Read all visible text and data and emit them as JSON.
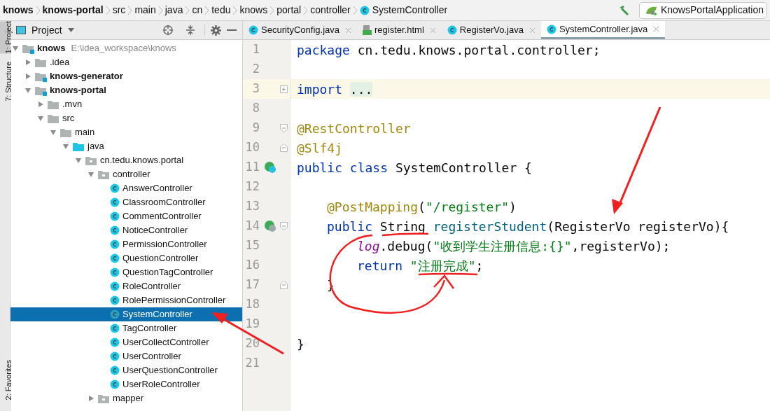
{
  "breadcrumbs": [
    {
      "label": "knows",
      "bold": true
    },
    {
      "label": "knows-portal",
      "bold": true
    },
    {
      "label": "src",
      "bold": false
    },
    {
      "label": "main",
      "bold": false
    },
    {
      "label": "java",
      "bold": false
    },
    {
      "label": "cn",
      "bold": false
    },
    {
      "label": "tedu",
      "bold": false
    },
    {
      "label": "knows",
      "bold": false
    },
    {
      "label": "portal",
      "bold": false
    },
    {
      "label": "controller",
      "bold": false
    },
    {
      "label": "SystemController",
      "bold": false,
      "kind": "class"
    }
  ],
  "run_config": {
    "label": "KnowsPortalApplication"
  },
  "side_tabs": [
    {
      "label": "1: Project",
      "selected": true
    },
    {
      "label": "7: Structure",
      "selected": false
    },
    {
      "label": "2: Favorites",
      "selected": false
    }
  ],
  "project_panel": {
    "title": "Project",
    "tree": [
      {
        "label": "knows",
        "kind": "module",
        "bold": true,
        "location": "E:\\idea_workspace\\knows",
        "expanded": true,
        "children": [
          {
            "label": ".idea",
            "kind": "folder",
            "expanded": false
          },
          {
            "label": "knows-generator",
            "kind": "module",
            "bold": true,
            "expanded": false
          },
          {
            "label": "knows-portal",
            "kind": "module",
            "bold": true,
            "expanded": true,
            "children": [
              {
                "label": ".mvn",
                "kind": "folder",
                "expanded": false
              },
              {
                "label": "src",
                "kind": "folder",
                "expanded": true,
                "children": [
                  {
                    "label": "main",
                    "kind": "folder",
                    "expanded": true,
                    "children": [
                      {
                        "label": "java",
                        "kind": "source-folder",
                        "expanded": true,
                        "children": [
                          {
                            "label": "cn.tedu.knows.portal",
                            "kind": "package",
                            "expanded": true,
                            "children": [
                              {
                                "label": "controller",
                                "kind": "package",
                                "expanded": true,
                                "children": [
                                  {
                                    "label": "AnswerController",
                                    "kind": "class",
                                    "selected": false
                                  },
                                  {
                                    "label": "ClassroomController",
                                    "kind": "class",
                                    "selected": false
                                  },
                                  {
                                    "label": "CommentController",
                                    "kind": "class",
                                    "selected": false
                                  },
                                  {
                                    "label": "NoticeController",
                                    "kind": "class",
                                    "selected": false
                                  },
                                  {
                                    "label": "PermissionController",
                                    "kind": "class",
                                    "selected": false
                                  },
                                  {
                                    "label": "QuestionController",
                                    "kind": "class",
                                    "selected": false
                                  },
                                  {
                                    "label": "QuestionTagController",
                                    "kind": "class",
                                    "selected": false
                                  },
                                  {
                                    "label": "RoleController",
                                    "kind": "class",
                                    "selected": false
                                  },
                                  {
                                    "label": "RolePermissionController",
                                    "kind": "class",
                                    "selected": false
                                  },
                                  {
                                    "label": "SystemController",
                                    "kind": "class",
                                    "selected": true
                                  },
                                  {
                                    "label": "TagController",
                                    "kind": "class",
                                    "selected": false
                                  },
                                  {
                                    "label": "UserCollectController",
                                    "kind": "class",
                                    "selected": false
                                  },
                                  {
                                    "label": "UserController",
                                    "kind": "class",
                                    "selected": false
                                  },
                                  {
                                    "label": "UserQuestionController",
                                    "kind": "class",
                                    "selected": false
                                  },
                                  {
                                    "label": "UserRoleController",
                                    "kind": "class",
                                    "selected": false
                                  }
                                ]
                              },
                              {
                                "label": "mapper",
                                "kind": "package",
                                "expanded": false
                              }
                            ]
                          }
                        ]
                      }
                    ]
                  }
                ]
              }
            ]
          }
        ]
      }
    ]
  },
  "editor_tabs": [
    {
      "label": "SecurityConfig.java",
      "kind": "class",
      "selected": false
    },
    {
      "label": "register.html",
      "kind": "html",
      "selected": false
    },
    {
      "label": "RegisterVo.java",
      "kind": "class",
      "selected": false
    },
    {
      "label": "SystemController.java",
      "kind": "class",
      "selected": true
    }
  ],
  "code_lines": [
    {
      "number": "1",
      "kind": "top",
      "tokens": [
        {
          "text": "package",
          "kind": "keyword"
        },
        {
          "text": " cn.tedu.knows.portal.controller;",
          "kind": "plain"
        }
      ]
    },
    {
      "number": "2",
      "kind": "blank"
    },
    {
      "number": "3",
      "kind": "top",
      "current": true,
      "collapsed_fold": true,
      "tokens": [
        {
          "text": "import ",
          "kind": "keyword"
        },
        {
          "text": "...",
          "kind": "folded"
        }
      ]
    },
    {
      "number": "8",
      "kind": "blank"
    },
    {
      "number": "9",
      "kind": "top",
      "fold_start": true,
      "tokens": [
        {
          "text": "@RestController",
          "kind": "annotation"
        }
      ]
    },
    {
      "number": "10",
      "kind": "top",
      "fold_end": true,
      "tokens": [
        {
          "text": "@Slf4j",
          "kind": "annotation"
        }
      ]
    },
    {
      "number": "11",
      "kind": "top",
      "bean_marker": true,
      "tokens": [
        {
          "text": "public class",
          "kind": "keyword"
        },
        {
          "text": " SystemController {",
          "kind": "plain"
        }
      ]
    },
    {
      "number": "12",
      "kind": "blank"
    },
    {
      "number": "13",
      "kind": "member",
      "tokens": [
        {
          "text": "@PostMapping",
          "kind": "annotation"
        },
        {
          "text": "(",
          "kind": "plain"
        },
        {
          "text": "\"/register\"",
          "kind": "string"
        },
        {
          "text": ")",
          "kind": "plain"
        }
      ]
    },
    {
      "number": "14",
      "kind": "member",
      "web_marker": true,
      "fold_start": true,
      "tokens": [
        {
          "text": "public",
          "kind": "keyword"
        },
        {
          "text": " String ",
          "kind": "plain"
        },
        {
          "text": "registerStudent",
          "kind": "method"
        },
        {
          "text": "(RegisterVo registerVo){",
          "kind": "plain"
        }
      ]
    },
    {
      "number": "15",
      "kind": "statement",
      "tokens": [
        {
          "text": "log",
          "kind": "field"
        },
        {
          "text": ".debug(",
          "kind": "plain"
        },
        {
          "text": "\"收到学生注册信息:{}\"",
          "kind": "string"
        },
        {
          "text": ",registerVo);",
          "kind": "plain"
        }
      ]
    },
    {
      "number": "16",
      "kind": "statement",
      "tokens": [
        {
          "text": "return ",
          "kind": "keyword"
        },
        {
          "text": "\"注册完成\"",
          "kind": "string"
        },
        {
          "text": ";",
          "kind": "plain"
        }
      ]
    },
    {
      "number": "17",
      "kind": "member",
      "fold_end": true,
      "tokens": [
        {
          "text": "}",
          "kind": "plain"
        }
      ]
    },
    {
      "number": "18",
      "kind": "blank"
    },
    {
      "number": "19",
      "kind": "blank"
    },
    {
      "number": "20",
      "kind": "top",
      "tokens": [
        {
          "text": "}",
          "kind": "plain"
        }
      ]
    },
    {
      "number": "21",
      "kind": "blank"
    }
  ]
}
